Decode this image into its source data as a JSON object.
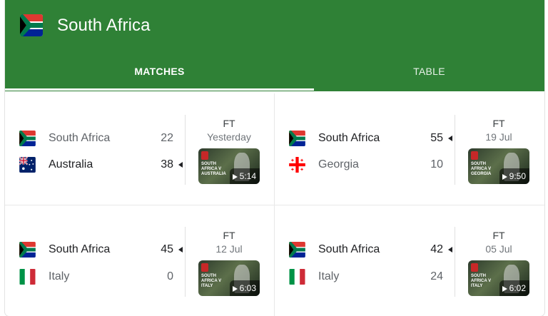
{
  "header": {
    "team": "South Africa",
    "flag_icon": "south-africa-flag-icon",
    "colors": {
      "header_bg": "#2f8136",
      "tab_active": "#ffffff"
    }
  },
  "tabs": [
    {
      "label": "MATCHES",
      "active": true
    },
    {
      "label": "TABLE",
      "active": false
    }
  ],
  "matches": [
    {
      "status": "FT",
      "date": "Yesterday",
      "teams": [
        {
          "name": "South Africa",
          "score": "22",
          "flag_icon": "south-africa-flag-icon",
          "winner": false
        },
        {
          "name": "Australia",
          "score": "38",
          "flag_icon": "australia-flag-icon",
          "winner": true
        }
      ],
      "video": {
        "duration": "5:14",
        "caption": "SOUTH AFRICA V AUSTRALIA"
      }
    },
    {
      "status": "FT",
      "date": "19 Jul",
      "teams": [
        {
          "name": "South Africa",
          "score": "55",
          "flag_icon": "south-africa-flag-icon",
          "winner": true
        },
        {
          "name": "Georgia",
          "score": "10",
          "flag_icon": "georgia-flag-icon",
          "winner": false
        }
      ],
      "video": {
        "duration": "9:50",
        "caption": "SOUTH AFRICA V GEORGIA"
      }
    },
    {
      "status": "FT",
      "date": "12 Jul",
      "teams": [
        {
          "name": "South Africa",
          "score": "45",
          "flag_icon": "south-africa-flag-icon",
          "winner": true
        },
        {
          "name": "Italy",
          "score": "0",
          "flag_icon": "italy-flag-icon",
          "winner": false
        }
      ],
      "video": {
        "duration": "6:03",
        "caption": "SOUTH AFRICA V ITALY"
      }
    },
    {
      "status": "FT",
      "date": "05 Jul",
      "teams": [
        {
          "name": "South Africa",
          "score": "42",
          "flag_icon": "south-africa-flag-icon",
          "winner": true
        },
        {
          "name": "Italy",
          "score": "24",
          "flag_icon": "italy-flag-icon",
          "winner": false
        }
      ],
      "video": {
        "duration": "6:02",
        "caption": "SOUTH AFRICA V ITALY"
      }
    }
  ]
}
